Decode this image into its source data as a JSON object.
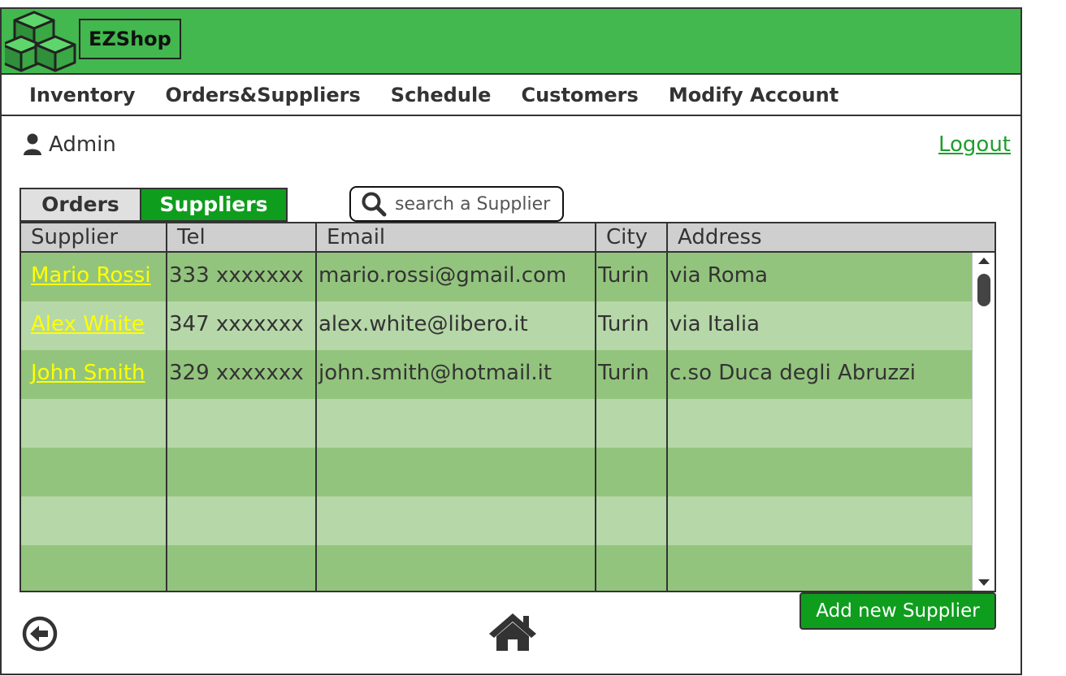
{
  "app": {
    "brand": "EZShop"
  },
  "nav": {
    "items": [
      {
        "label": "Inventory"
      },
      {
        "label": "Orders&Suppliers"
      },
      {
        "label": "Schedule"
      },
      {
        "label": "Customers"
      },
      {
        "label": "Modify Account"
      }
    ]
  },
  "user": {
    "name": "Admin",
    "logout_label": "Logout"
  },
  "tabs": [
    {
      "label": "Orders",
      "active": false
    },
    {
      "label": "Suppliers",
      "active": true
    }
  ],
  "search": {
    "placeholder": "search a Supplier"
  },
  "table": {
    "columns": [
      "Supplier",
      "Tel",
      "Email",
      "City",
      "Address"
    ],
    "rows": [
      {
        "supplier": "Mario Rossi",
        "tel": "333 xxxxxxx",
        "email": "mario.rossi@gmail.com",
        "city": "Turin",
        "address": "via Roma"
      },
      {
        "supplier": "Alex White",
        "tel": "347 xxxxxxx",
        "email": "alex.white@libero.it",
        "city": "Turin",
        "address": "via Italia"
      },
      {
        "supplier": "John Smith",
        "tel": "329 xxxxxxx",
        "email": "john.smith@hotmail.it",
        "city": "Turin",
        "address": "c.so Duca degli Abruzzi"
      }
    ]
  },
  "actions": {
    "add_label": "Add new Supplier"
  },
  "icons": {
    "logo": "cubes-logo-icon",
    "user": "user-icon",
    "search": "search-icon",
    "back": "back-arrow-icon",
    "home": "home-icon"
  },
  "colors": {
    "header": "#42b84e",
    "accent": "#0f9d1e",
    "row_dark": "#93c47d",
    "row_light": "#b6d7a8",
    "link": "#ffff00",
    "logout": "#1f9e2c"
  }
}
